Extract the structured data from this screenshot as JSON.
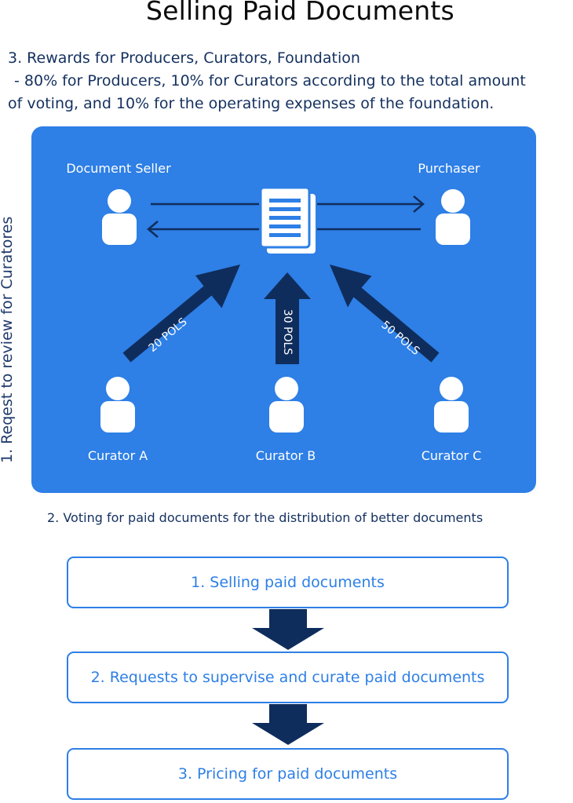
{
  "title": "Selling Paid Documents",
  "description": {
    "line1": "3. Rewards for Producers, Curators, Foundation",
    "line2": "- 80% for Producers, 10% for Curators according to the total amount",
    "line3": "of voting, and 10% for the operating expenses of the foundation."
  },
  "side_label": "1. Reqest to review for Curatores",
  "diagram": {
    "seller": "Document Seller",
    "purchaser": "Purchaser",
    "curators": [
      {
        "name": "Curator A",
        "vote": "20 POLS"
      },
      {
        "name": "Curator B",
        "vote": "30 POLS"
      },
      {
        "name": "Curator C",
        "vote": "50 POLS"
      }
    ],
    "colors": {
      "panel": "#2e7fe6",
      "arrow": "#0f2d5c",
      "figure": "#ffffff"
    }
  },
  "caption": "2. Voting for paid documents for the distribution of better documents",
  "steps": [
    "1. Selling paid documents",
    "2. Requests to supervise and curate paid documents",
    "3. Pricing for paid documents"
  ]
}
